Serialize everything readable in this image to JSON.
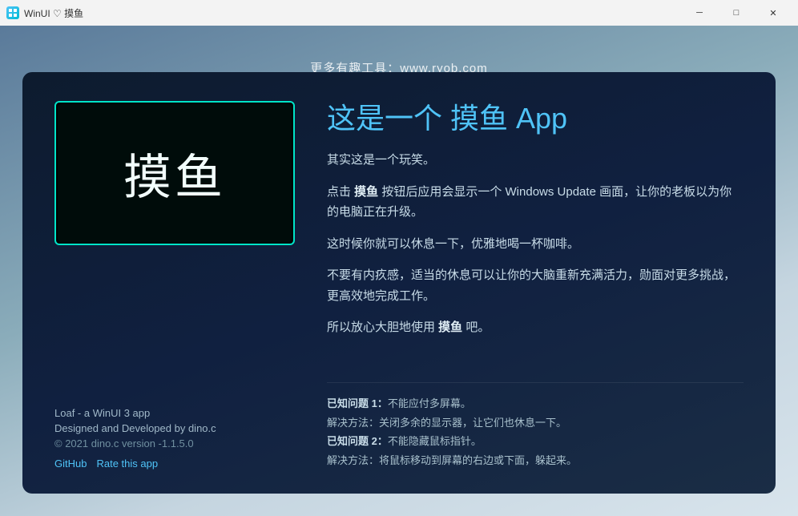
{
  "titleBar": {
    "appName": "WinUI ♡ 摸鱼",
    "minimizeLabel": "─",
    "maximizeLabel": "□",
    "closeLabel": "✕"
  },
  "topBanner": {
    "text": "更多有趣工具：www.ryob.com"
  },
  "card": {
    "logoText": "摸鱼",
    "appTitle": "这是一个 摸鱼 App",
    "descriptions": [
      {
        "text": "其实这是一个玩笑。",
        "bold": ""
      },
      {
        "text": "点击 {摸鱼} 按钮后应用会显示一个 Windows Update 画面，让你的老板以为你的电脑正在升级。",
        "boldWord": "摸鱼"
      },
      {
        "text": "这时候你就可以休息一下，优雅地喝一杯咖啡。",
        "bold": ""
      },
      {
        "text": "不要有内疚感，适当的休息可以让你的大脑重新充满活力，勋面对更多挑战，更高效地完成工作。",
        "bold": ""
      },
      {
        "text": "所以放心大胆地使用 {摸鱼} 吧。",
        "boldWord": "摸鱼"
      }
    ],
    "issues": [
      {
        "label": "已知问题 1：不能应付多屏幕。",
        "solution": "解决方法：关闭多余的显示器，让它们也休息一下。"
      },
      {
        "label": "已知问题 2：不能隐藏鼠标指针。",
        "solution": "解决方法：将鼠标移动到屏幕的右边或下面，躲起来。"
      }
    ],
    "footer": {
      "appLine": "Loaf - a WinUI 3 app",
      "devLine": "Designed and Developed by dino.c",
      "copyright": "© 2021 dino.c    version -1.1.5.0",
      "githubLink": "GitHub",
      "rateLink": "Rate this app"
    }
  }
}
